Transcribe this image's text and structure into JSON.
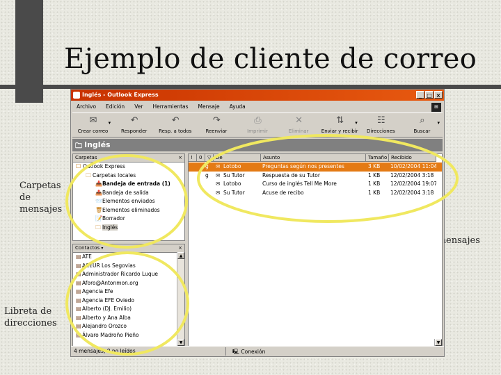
{
  "slide": {
    "title": "Ejemplo de cliente de correo",
    "callouts": {
      "folders": [
        "Carpetas",
        "de",
        "mensajes"
      ],
      "messages": "Lista de mensajes",
      "contacts": [
        "Libreta de",
        "direcciones"
      ]
    },
    "highlight_color": "#f0e860"
  },
  "window": {
    "title": "Inglés - Outlook Express",
    "controls": {
      "minimize": "_",
      "maximize": "□",
      "close": "×"
    },
    "menu": [
      "Archivo",
      "Edición",
      "Ver",
      "Herramientas",
      "Mensaje",
      "Ayuda"
    ],
    "toolbar": [
      {
        "label": "Crear correo",
        "icon": "new-mail-icon",
        "glyph": "✉",
        "dropdown": true,
        "enabled": true
      },
      {
        "label": "Responder",
        "icon": "reply-icon",
        "glyph": "↶",
        "dropdown": false,
        "enabled": true
      },
      {
        "label": "Resp. a todos",
        "icon": "reply-all-icon",
        "glyph": "↶",
        "dropdown": false,
        "enabled": true
      },
      {
        "label": "Reenviar",
        "icon": "forward-icon",
        "glyph": "↷",
        "dropdown": false,
        "enabled": true
      },
      {
        "label": "Imprimir",
        "icon": "print-icon",
        "glyph": "⎙",
        "dropdown": false,
        "enabled": false
      },
      {
        "label": "Eliminar",
        "icon": "delete-icon",
        "glyph": "✕",
        "dropdown": false,
        "enabled": false
      },
      {
        "label": "Enviar y recibir",
        "icon": "send-receive-icon",
        "glyph": "⇅",
        "dropdown": true,
        "enabled": true
      },
      {
        "label": "Direcciones",
        "icon": "address-book-icon",
        "glyph": "☷",
        "dropdown": false,
        "enabled": true
      },
      {
        "label": "Buscar",
        "icon": "find-icon",
        "glyph": "⌕",
        "dropdown": true,
        "enabled": true
      }
    ],
    "folder_bar_title": "Inglés",
    "folders_pane": {
      "header": "Carpetas",
      "items": [
        {
          "label": "Outlook Express",
          "indent": 0,
          "bold": false,
          "selected": false
        },
        {
          "label": "Carpetas locales",
          "indent": 1,
          "bold": false,
          "selected": false
        },
        {
          "label": "Bandeja de entrada (1)",
          "indent": 2,
          "bold": true,
          "selected": false
        },
        {
          "label": "Bandeja de salida",
          "indent": 2,
          "bold": false,
          "selected": false
        },
        {
          "label": "Elementos enviados",
          "indent": 2,
          "bold": false,
          "selected": false
        },
        {
          "label": "Elementos eliminados",
          "indent": 2,
          "bold": false,
          "selected": false
        },
        {
          "label": "Borrador",
          "indent": 2,
          "bold": false,
          "selected": false
        },
        {
          "label": "Inglés",
          "indent": 2,
          "bold": false,
          "selected": true
        }
      ]
    },
    "contacts_pane": {
      "header": "Contactos",
      "items": [
        "ATE",
        "ACEUR Los Segovias",
        "Administrador Ricardo Luque",
        "Aforo@Antonmon.org",
        "Agencia Efe",
        "Agencia EFE Oviedo",
        "Alberto (DJ. Emilio)",
        "Alberto y Ana Alba",
        "Alejandro Orozco",
        "Álvaro Madroño Pieño"
      ]
    },
    "message_list": {
      "columns": [
        "!",
        "0",
        "▽",
        "De",
        "Asunto",
        "Tamaño",
        "Recibido"
      ],
      "rows": [
        {
          "flag": "g",
          "from": "Lotobo",
          "subject": "Preguntas según nos presentes",
          "size": "3 KB",
          "received": "10/02/2004 11:04",
          "selected": true
        },
        {
          "flag": "g",
          "from": "Su Tutor",
          "subject": "Respuesta de su Tutor",
          "size": "1 KB",
          "received": "12/02/2004 3:18",
          "selected": false
        },
        {
          "flag": "",
          "from": "Lotobo",
          "subject": "Curso de inglés Tell Me More",
          "size": "1 KB",
          "received": "12/02/2004 19:07",
          "selected": false
        },
        {
          "flag": "",
          "from": "Su Tutor",
          "subject": "Acuse de recibo",
          "size": "1 KB",
          "received": "12/02/2004 3:18",
          "selected": false
        }
      ]
    },
    "status": {
      "left": "4 mensajes, 0 no leídos",
      "right": "Conexión"
    }
  }
}
